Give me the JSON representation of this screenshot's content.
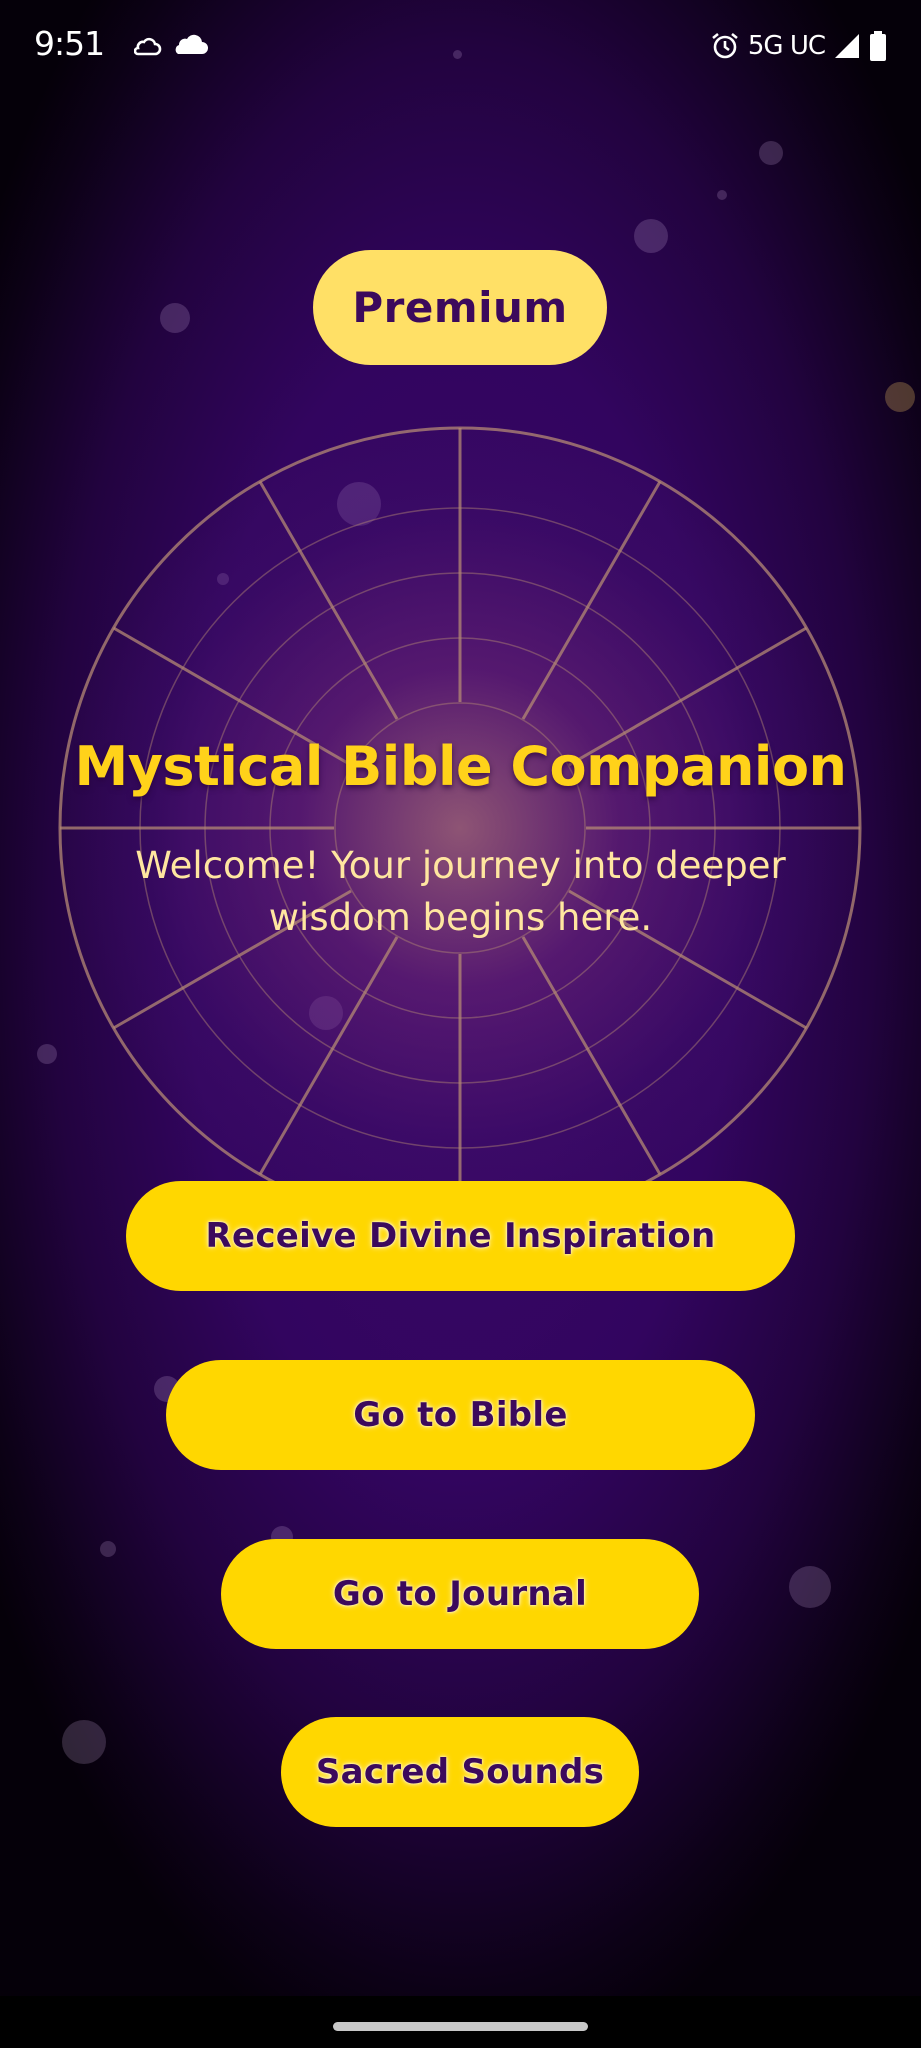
{
  "status_bar": {
    "time": "9:51",
    "network": "5G UC",
    "icons": [
      "weather-icon",
      "cloud-icon",
      "alarm-icon",
      "signal-icon",
      "battery-icon"
    ]
  },
  "premium": {
    "label": "Premium"
  },
  "hero": {
    "title": "Mystical Bible Companion",
    "subtitle": "Welcome! Your journey into deeper wisdom begins here."
  },
  "actions": [
    {
      "label": "Receive Divine Inspiration"
    },
    {
      "label": "Go to Bible"
    },
    {
      "label": "Go to Journal"
    },
    {
      "label": "Sacred Sounds"
    }
  ],
  "colors": {
    "background": "#32055f",
    "premium_button": "#ffe066",
    "action_button": "#ffd700",
    "button_text": "#3c0a5c",
    "title_text": "#ffd21a",
    "subtitle_text": "#ffe6a0",
    "wheel_lines": "#b48a74"
  }
}
